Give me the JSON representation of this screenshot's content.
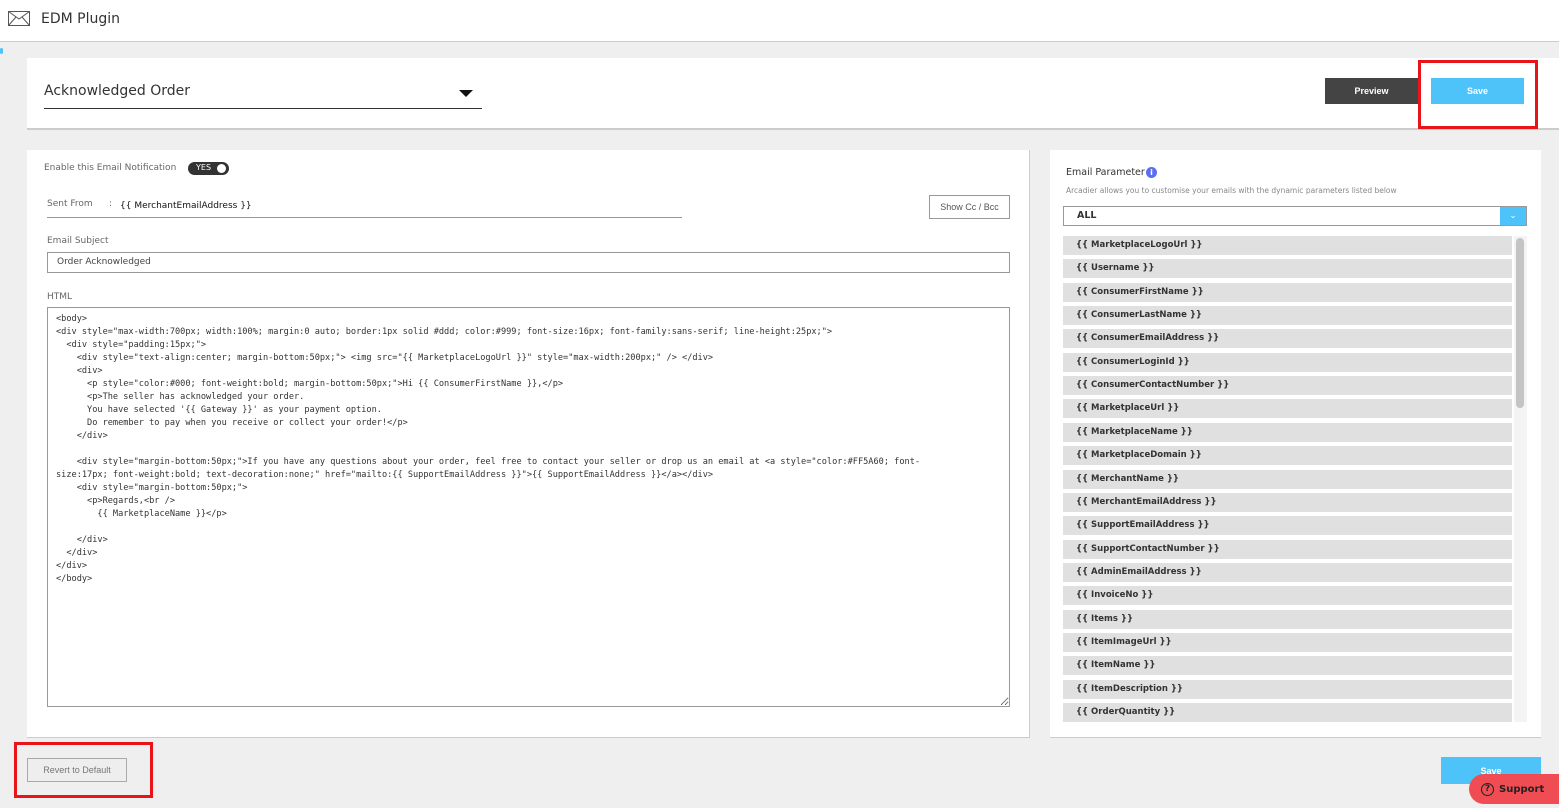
{
  "header": {
    "title": "EDM Plugin",
    "icon": "envelope-icon"
  },
  "template_select": {
    "value": "Acknowledged Order"
  },
  "toolbar": {
    "preview_label": "Preview",
    "save_label": "Save"
  },
  "form": {
    "enable_label": "Enable this Email Notification",
    "enable_toggle": "YES",
    "sent_from_label": "Sent From",
    "sent_from_sep": ":",
    "sent_from_value": "{{ MerchantEmailAddress }}",
    "show_cc_label": "Show Cc / Bcc",
    "subject_label": "Email Subject",
    "subject_value": "Order Acknowledged",
    "html_label": "HTML",
    "html_value": "<body>\n<div style=\"max-width:700px; width:100%; margin:0 auto; border:1px solid #ddd; color:#999; font-size:16px; font-family:sans-serif; line-height:25px;\">\n  <div style=\"padding:15px;\">\n    <div style=\"text-align:center; margin-bottom:50px;\"> <img src=\"{{ MarketplaceLogoUrl }}\" style=\"max-width:200px;\" /> </div>\n    <div>\n      <p style=\"color:#000; font-weight:bold; margin-bottom:50px;\">Hi {{ ConsumerFirstName }},</p>\n      <p>The seller has acknowledged your order.\n      You have selected '{{ Gateway }}' as your payment option.\n      Do remember to pay when you receive or collect your order!</p>\n    </div>\n\n    <div style=\"margin-bottom:50px;\">If you have any questions about your order, feel free to contact your seller or drop us an email at <a style=\"color:#FF5A60; font-\nsize:17px; font-weight:bold; text-decoration:none;\" href=\"mailto:{{ SupportEmailAddress }}\">{{ SupportEmailAddress }}</a></div>\n    <div style=\"margin-bottom:50px;\">\n      <p>Regards,<br />\n        {{ MarketplaceName }}</p>\n\n    </div>\n  </div>\n</div>\n</body>"
  },
  "params": {
    "title": "Email Parameter",
    "description": "Arcadier allows you to customise your emails with the dynamic parameters listed below",
    "filter_value": "ALL",
    "items": [
      "{{ MarketplaceLogoUrl }}",
      "{{ Username }}",
      "{{ ConsumerFirstName }}",
      "{{ ConsumerLastName }}",
      "{{ ConsumerEmailAddress }}",
      "{{ ConsumerLoginId }}",
      "{{ ConsumerContactNumber }}",
      "{{ MarketplaceUrl }}",
      "{{ MarketplaceName }}",
      "{{ MarketplaceDomain }}",
      "{{ MerchantName }}",
      "{{ MerchantEmailAddress }}",
      "{{ SupportEmailAddress }}",
      "{{ SupportContactNumber }}",
      "{{ AdminEmailAddress }}",
      "{{ InvoiceNo }}",
      "{{ Items }}",
      "{{ ItemImageUrl }}",
      "{{ ItemName }}",
      "{{ ItemDescription }}",
      "{{ OrderQuantity }}"
    ]
  },
  "footer": {
    "revert_label": "Revert to Default",
    "save_label": "Save",
    "support_label": "Support"
  },
  "colors": {
    "accent": "#4dc3fa",
    "dark_button": "#444444",
    "highlight": "#e8141a",
    "support": "#f04c53"
  }
}
